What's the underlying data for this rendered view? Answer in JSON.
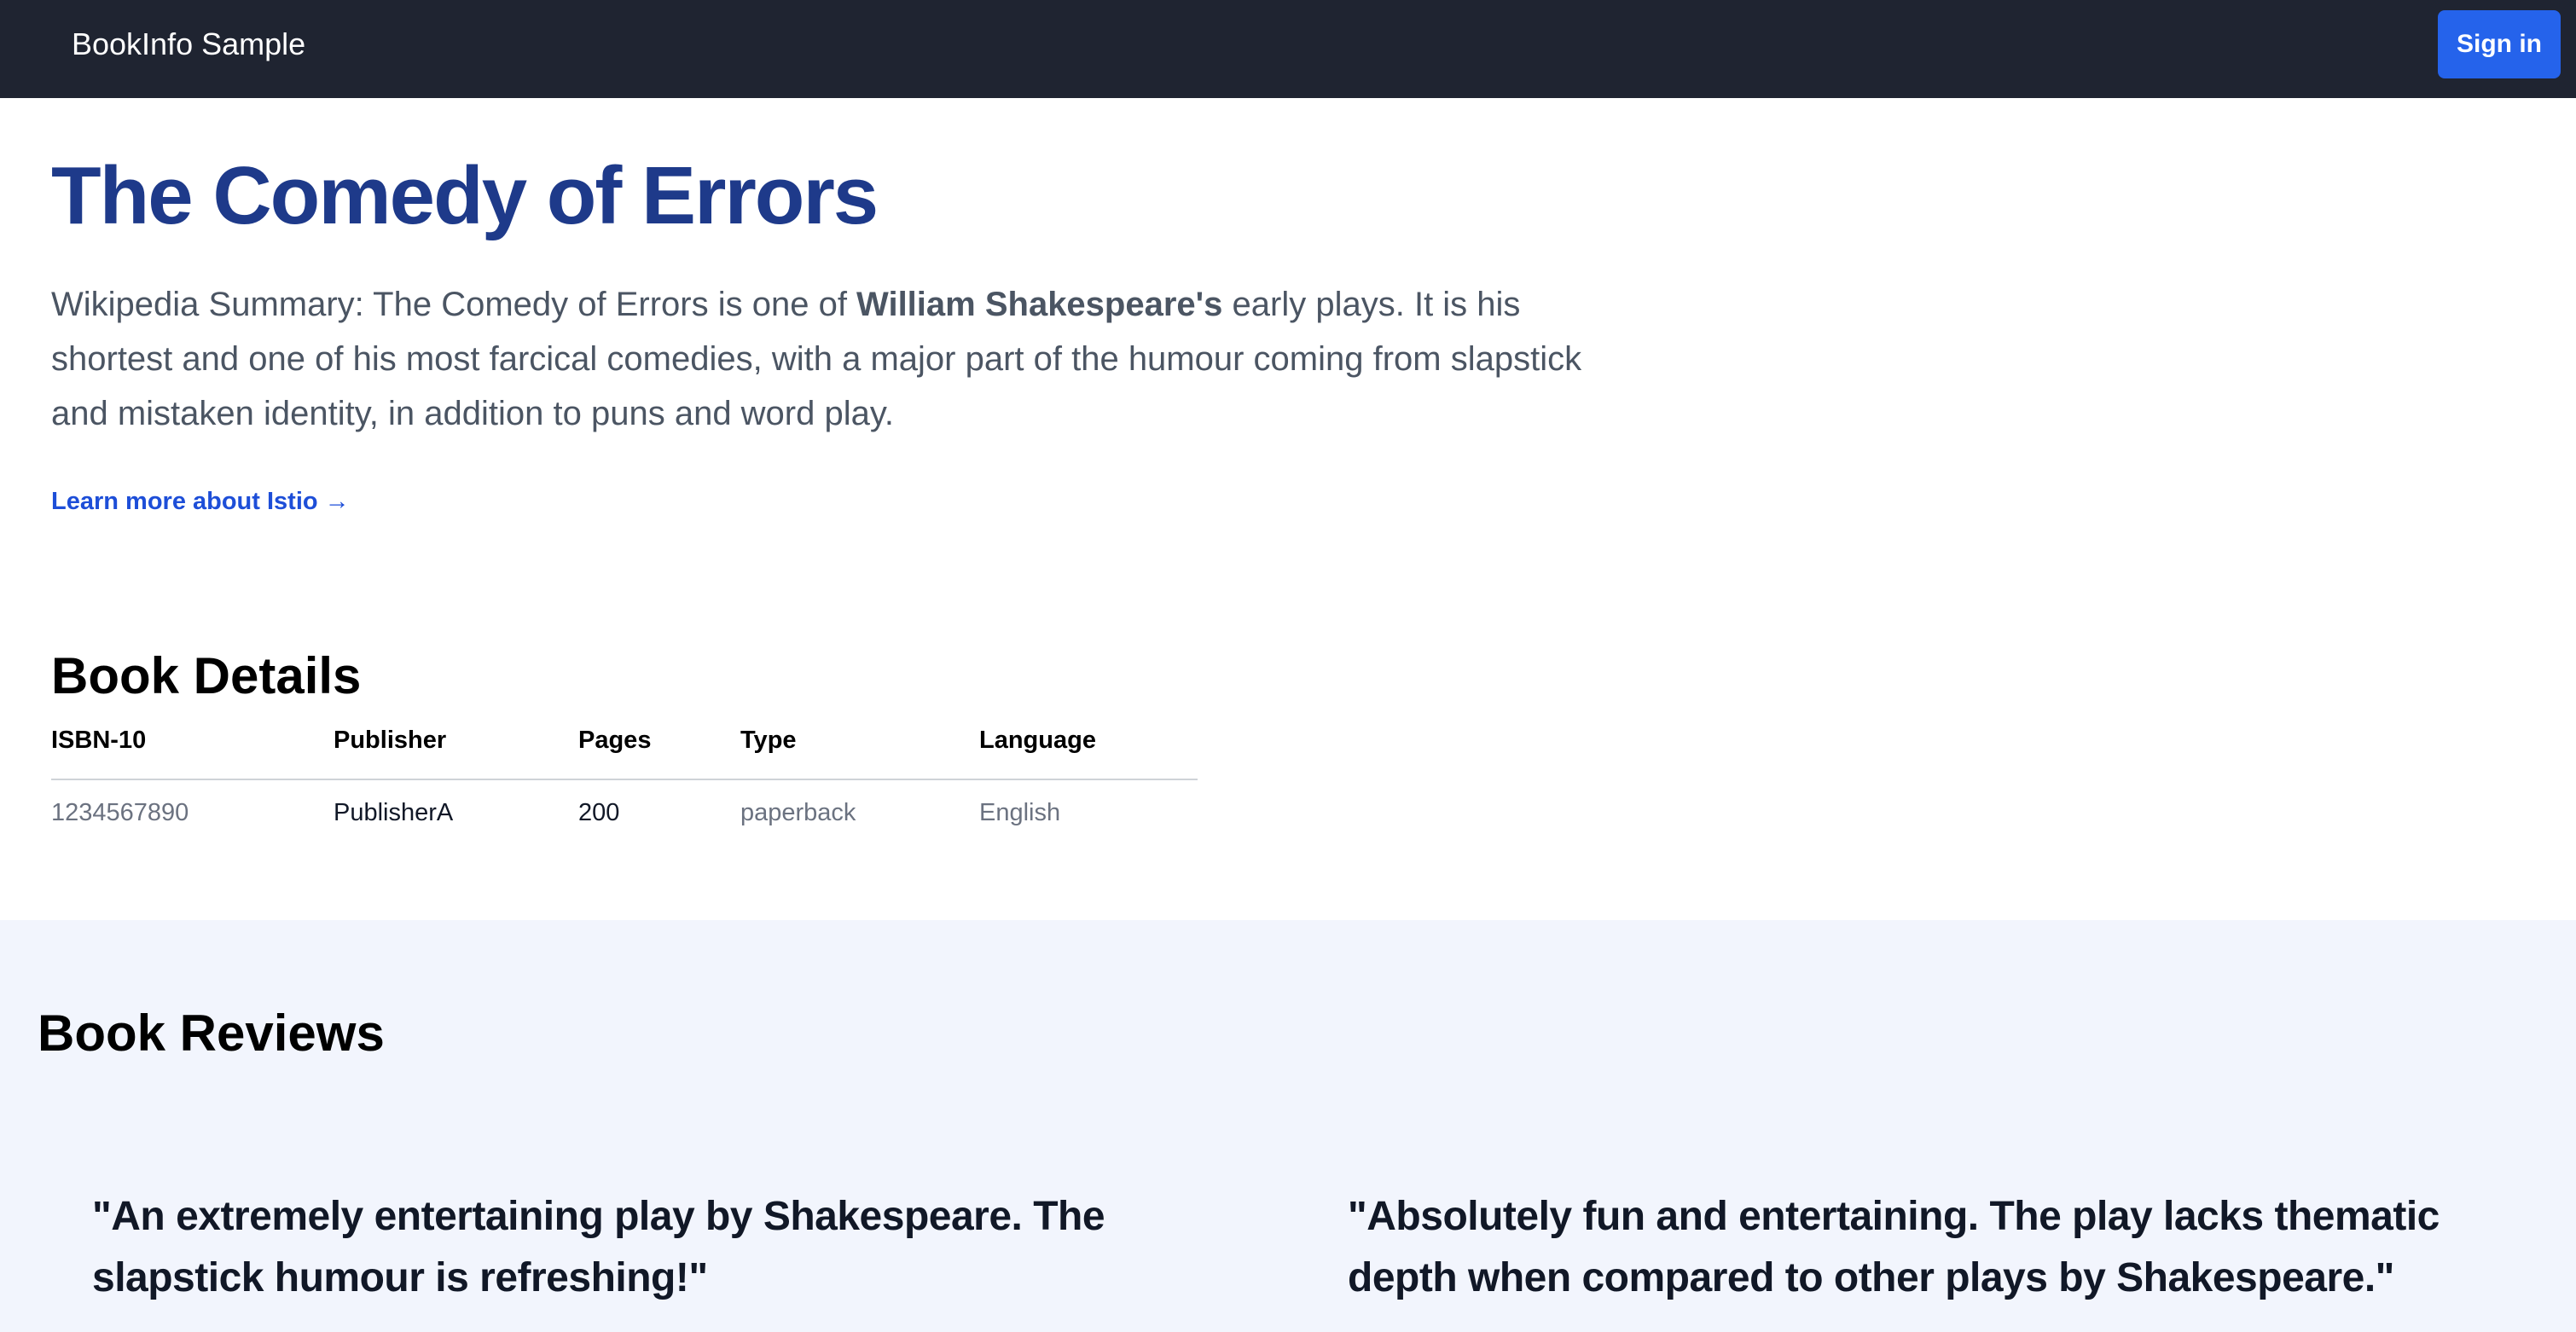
{
  "header": {
    "brand": "BookInfo Sample",
    "signin_label": "Sign in"
  },
  "hero": {
    "title": "The Comedy of Errors",
    "summary_prefix": "Wikipedia Summary: The Comedy of Errors is one of ",
    "summary_bold": "William Shakespeare's",
    "summary_suffix": " early plays. It is his shortest and one of his most farcical comedies, with a major part of the humour coming from slapstick and mistaken identity, in addition to puns and word play.",
    "learn_more": "Learn more about Istio →"
  },
  "details": {
    "title": "Book Details",
    "columns": [
      "ISBN-10",
      "Publisher",
      "Pages",
      "Type",
      "Language"
    ],
    "row": [
      "1234567890",
      "PublisherA",
      "200",
      "paperback",
      "English"
    ]
  },
  "reviews": {
    "title": "Book Reviews",
    "items": [
      {
        "text": "\"An extremely entertaining play by Shakespeare. The slapstick humour is refreshing!\""
      },
      {
        "text": "\"Absolutely fun and entertaining. The play lacks thematic depth when compared to other plays by Shakespeare.\""
      }
    ]
  }
}
